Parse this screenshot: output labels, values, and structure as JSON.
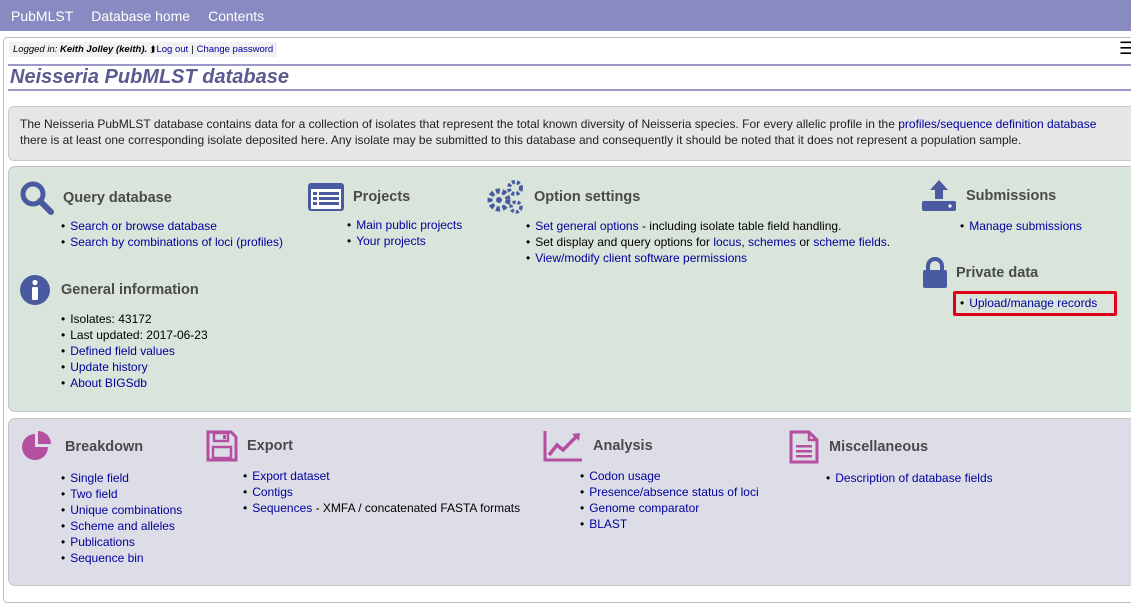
{
  "nav": {
    "items": [
      "PubMLST",
      "Database home",
      "Contents"
    ]
  },
  "login": {
    "prefix": "Logged in:",
    "user": "Keith Jolley (keith).",
    "logout": "Log out",
    "separator": "|",
    "change_password": "Change password"
  },
  "page": {
    "title": "Neisseria PubMLST database"
  },
  "intro": {
    "text_before_link": "The Neisseria PubMLST database contains data for a collection of isolates that represent the total known diversity of Neisseria species. For every allelic profile in the ",
    "link": "profiles/sequence definition database",
    "text_after_link": "there is at least one corresponding isolate deposited here. Any isolate may be submitted to this database and consequently it should be noted that it does not represent a population sample."
  },
  "query": {
    "title": "Query database",
    "items": [
      "Search or browse database",
      "Search by combinations of loci (profiles)"
    ]
  },
  "projects": {
    "title": "Projects",
    "items": [
      "Main public projects",
      "Your projects"
    ]
  },
  "options": {
    "title": "Option settings",
    "item1_link": "Set general options",
    "item1_rest": " - including isolate table field handling.",
    "item2_prefix": "Set display and query options for ",
    "item2_locus": "locus",
    "item2_sep1": ", ",
    "item2_schemes": "schemes",
    "item2_sep2": " or ",
    "item2_fields": "scheme fields",
    "item2_end": ".",
    "item3_link": "View/modify client software permissions"
  },
  "submissions": {
    "title": "Submissions",
    "items": [
      "Manage submissions"
    ]
  },
  "private": {
    "title": "Private data",
    "items": [
      "Upload/manage records"
    ]
  },
  "general": {
    "title": "General information",
    "isolates": "Isolates: 43172",
    "updated": "Last updated: 2017-06-23",
    "links": [
      "Defined field values",
      "Update history",
      "About BIGSdb"
    ]
  },
  "breakdown": {
    "title": "Breakdown",
    "items": [
      "Single field",
      "Two field",
      "Unique combinations",
      "Scheme and alleles",
      "Publications",
      "Sequence bin"
    ]
  },
  "export": {
    "title": "Export",
    "items": [
      "Export dataset",
      "Contigs"
    ],
    "seq_link": "Sequences",
    "seq_rest": " - XMFA / concatenated FASTA formats"
  },
  "analysis": {
    "title": "Analysis",
    "items": [
      "Codon usage",
      "Presence/absence status of loci",
      "Genome comparator",
      "BLAST"
    ]
  },
  "misc": {
    "title": "Miscellaneous",
    "items": [
      "Description of database fields"
    ]
  },
  "colors": {
    "nav_bg": "#8a8ac2",
    "title_text": "#5b5b8f",
    "icon_blue": "#4a5aa0",
    "icon_pink": "#b54fa0",
    "green_panel": "#d9e5da",
    "lavender_panel": "#dddde8",
    "highlight": "#e0001a"
  }
}
